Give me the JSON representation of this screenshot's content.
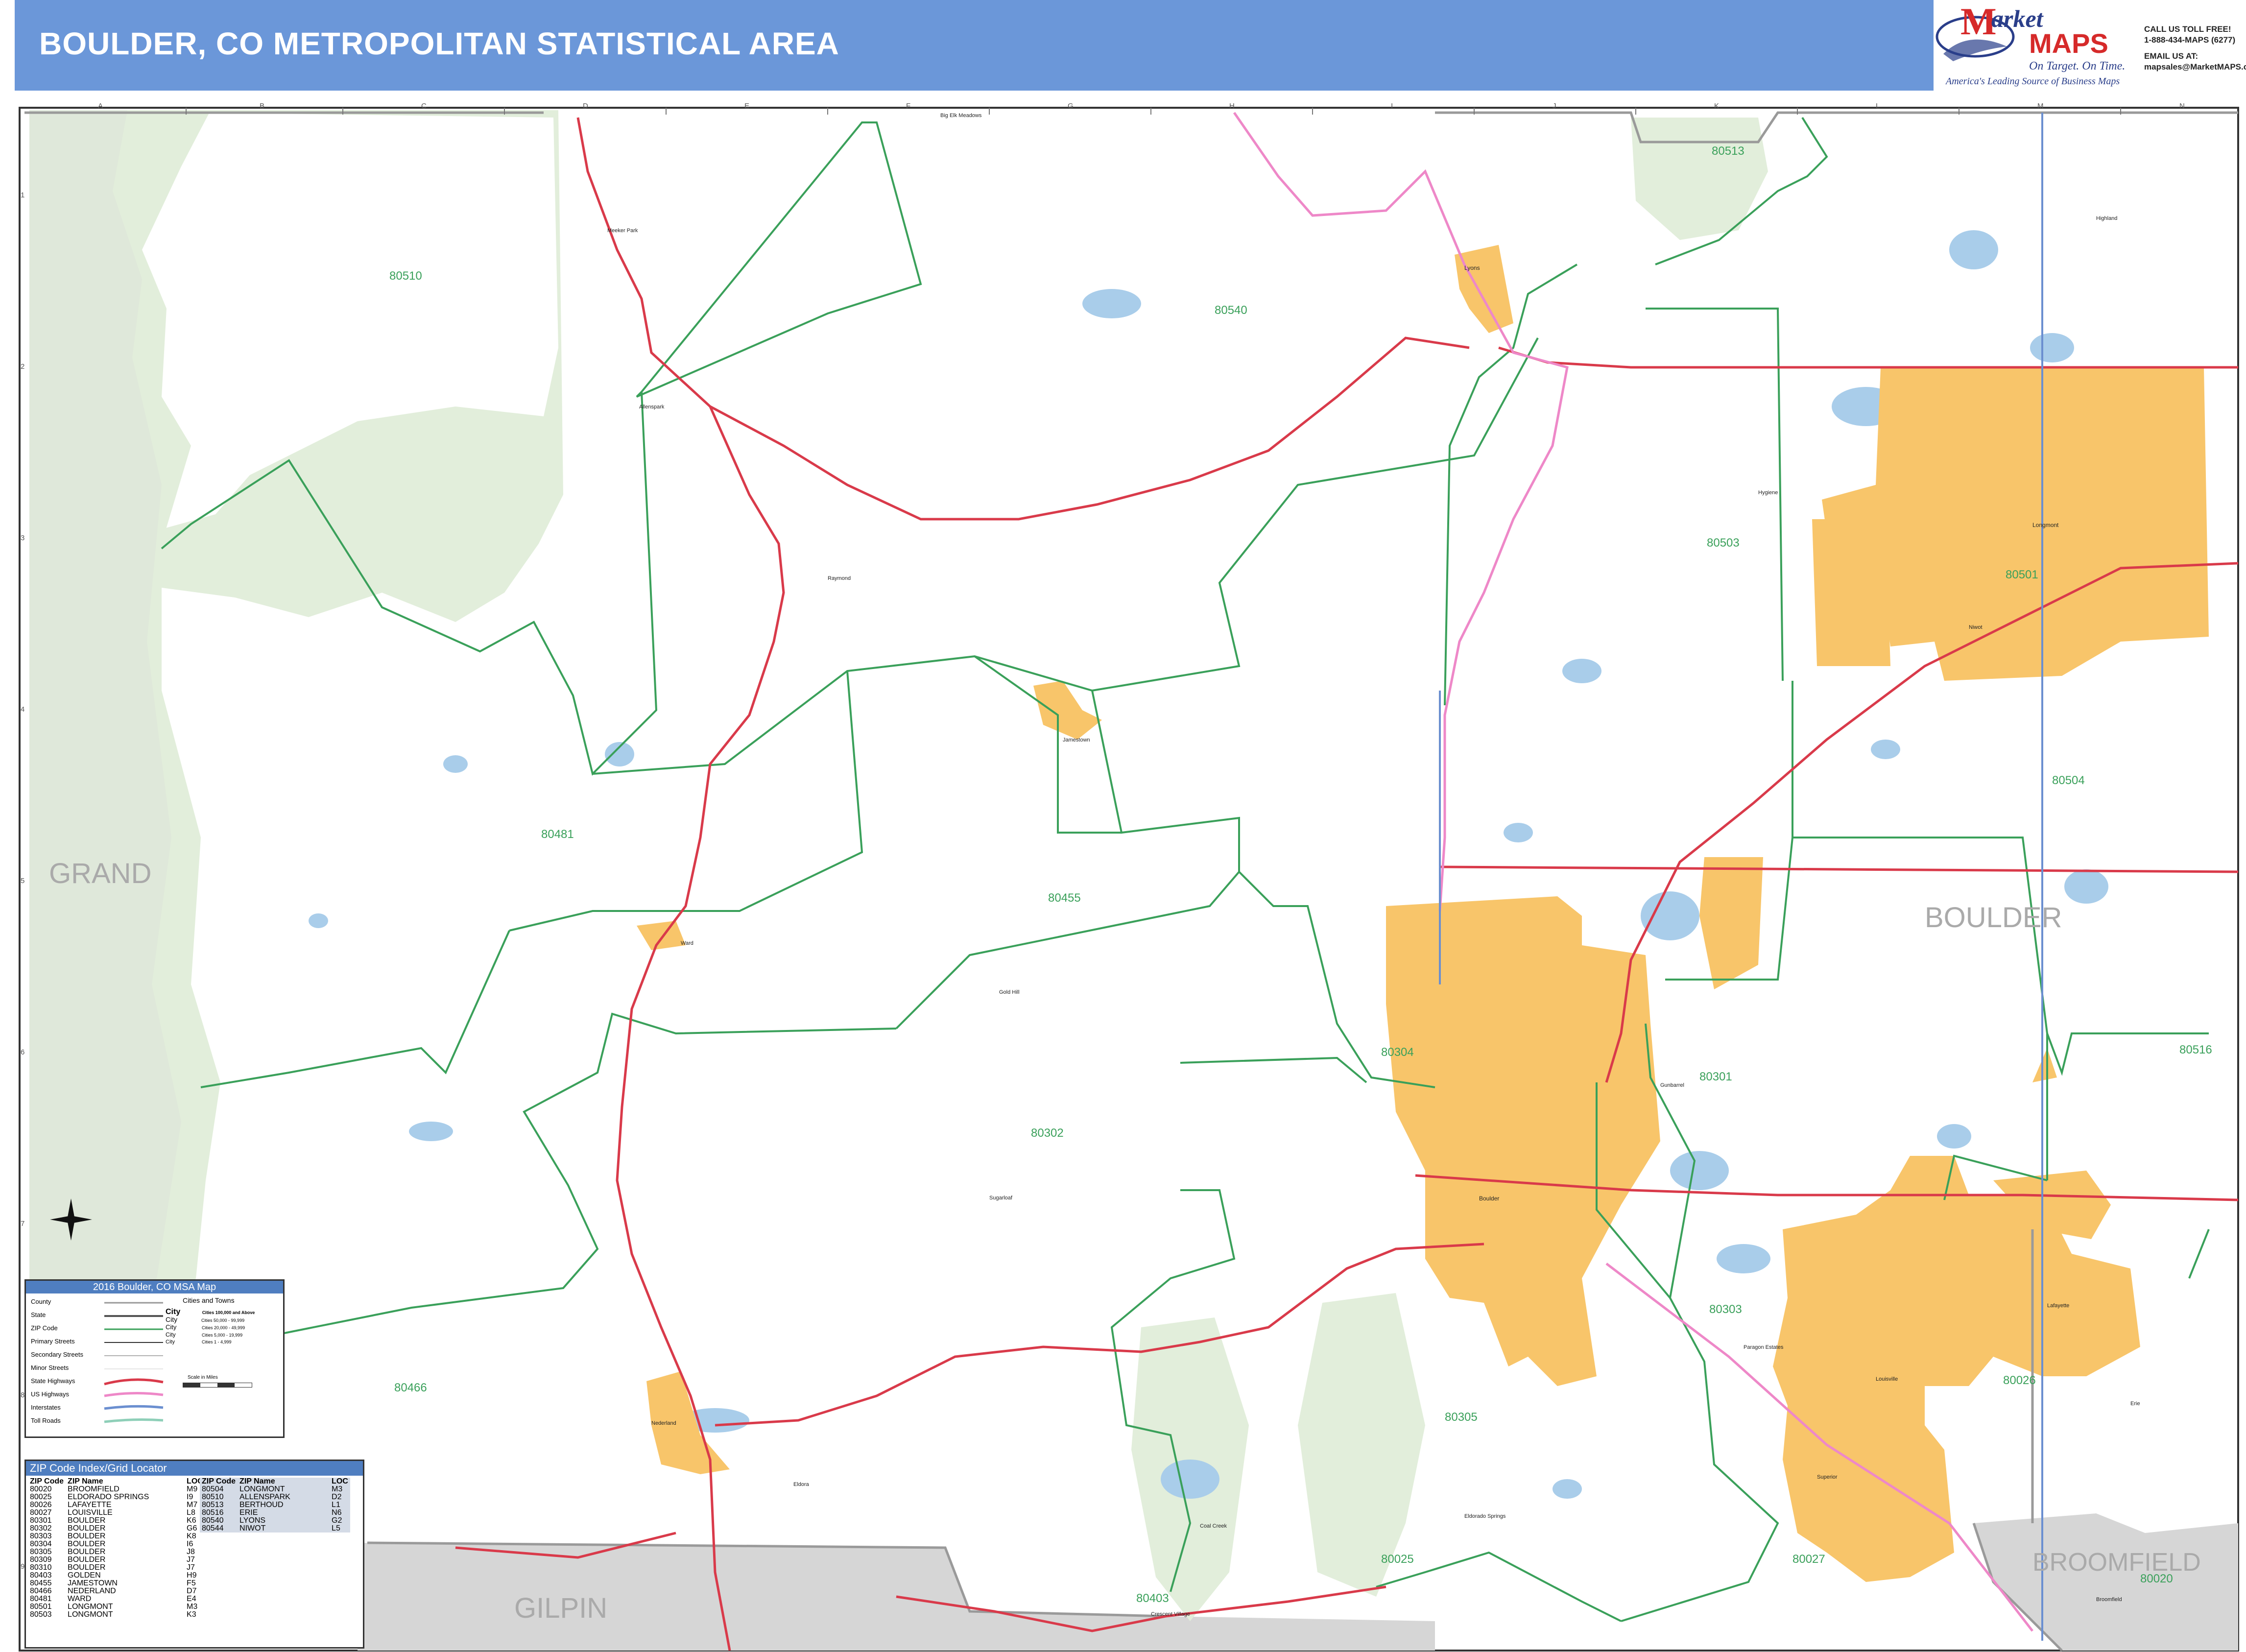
{
  "header": {
    "title": "BOULDER, CO METROPOLITAN STATISTICAL AREA",
    "bg_color": "#6b97d9"
  },
  "brand": {
    "logo_m": "M",
    "logo_rest": "arket",
    "logo_maps": "MAPS",
    "tagline1": "On Target.  On Time.",
    "tagline2": "America's Leading Source of Business Maps",
    "call": "CALL US TOLL FREE!",
    "phone": "1-888-434-MAPS (6277)",
    "email_label": "EMAIL US AT:",
    "email": "mapsales@MarketMAPS.com"
  },
  "grid": {
    "columns": [
      "A",
      "B",
      "C",
      "D",
      "E",
      "F",
      "G",
      "H",
      "I",
      "J",
      "K",
      "L",
      "M",
      "N"
    ],
    "rows": [
      "1",
      "2",
      "3",
      "4",
      "5",
      "6",
      "7",
      "8",
      "9"
    ]
  },
  "counties": {
    "grand": "GRAND",
    "boulder": "BOULDER",
    "gilpin": "GILPIN",
    "broomfield": "BROOMFIELD"
  },
  "zips": {
    "z80510": "80510",
    "z80540": "80540",
    "z80513": "80513",
    "z80503": "80503",
    "z80501": "80501",
    "z80504": "80504",
    "z80481": "80481",
    "z80455": "80455",
    "z80304": "80304",
    "z80301": "80301",
    "z80516": "80516",
    "z80302": "80302",
    "z80303": "80303",
    "z80026": "80026",
    "z80466": "80466",
    "z80305": "80305",
    "z80027": "80027",
    "z80025": "80025",
    "z80403": "80403",
    "z80020": "80020"
  },
  "places": {
    "big_elk": "Big Elk Meadows",
    "meeker": "Meeker Park",
    "lyons": "Lyons",
    "longmont": "Longmont",
    "allenspark": "Allenspark",
    "raymond": "Raymond",
    "jamestown": "Jamestown",
    "ward": "Ward",
    "gold_hill": "Gold Hill",
    "niwot": "Niwot",
    "gunbarrel": "Gunbarrel",
    "boulder": "Boulder",
    "sugarloaf": "Sugarloaf",
    "nederland": "Nederland",
    "eldora": "Eldora",
    "superior": "Superior",
    "louisville": "Louisville",
    "lafayette": "Lafayette",
    "erie": "Erie",
    "broomfield": "Broomfield",
    "eldorado": "Eldorado Springs",
    "coal_creek": "Coal Creek",
    "crescent": "Crescent Village",
    "hygiene": "Hygiene",
    "highland": "Highland",
    "paragon": "Paragon Estates"
  },
  "legend": {
    "title": "2016 Boulder, CO MSA Map",
    "items": [
      "County",
      "State",
      "ZIP Code",
      "Primary Streets",
      "Secondary Streets",
      "Minor Streets",
      "State Highways",
      "US Highways",
      "Interstates",
      "Toll Roads"
    ],
    "cities_title": "Cities and Towns",
    "city_samples": [
      "City",
      "City",
      "City",
      "City",
      "City"
    ],
    "city_sizes": [
      "Cities 100,000 and Above",
      "Cities 50,000 - 99,999",
      "Cities 20,000 - 49,999",
      "Cities 5,000 - 19,999",
      "Cities 1 - 4,999"
    ],
    "scale": "Scale in Miles"
  },
  "zip_index": {
    "title": "ZIP Code Index/Grid Locator",
    "headers": [
      "ZIP Code",
      "ZIP Name",
      "LOC",
      "ZIP Code",
      "ZIP Name",
      "LOC"
    ],
    "left": [
      [
        "80020",
        "BROOMFIELD",
        "M9"
      ],
      [
        "80025",
        "ELDORADO SPRINGS",
        "I9"
      ],
      [
        "80026",
        "LAFAYETTE",
        "M7"
      ],
      [
        "80027",
        "LOUISVILLE",
        "L8"
      ],
      [
        "80301",
        "BOULDER",
        "K6"
      ],
      [
        "80302",
        "BOULDER",
        "G6"
      ],
      [
        "80303",
        "BOULDER",
        "K8"
      ],
      [
        "80304",
        "BOULDER",
        "I6"
      ],
      [
        "80305",
        "BOULDER",
        "J8"
      ],
      [
        "80309",
        "BOULDER",
        "J7"
      ],
      [
        "80310",
        "BOULDER",
        "J7"
      ],
      [
        "80403",
        "GOLDEN",
        "H9"
      ],
      [
        "80455",
        "JAMESTOWN",
        "F5"
      ],
      [
        "80466",
        "NEDERLAND",
        "D7"
      ],
      [
        "80481",
        "WARD",
        "E4"
      ],
      [
        "80501",
        "LONGMONT",
        "M3"
      ],
      [
        "80503",
        "LONGMONT",
        "K3"
      ]
    ],
    "right": [
      [
        "80504",
        "LONGMONT",
        "M3"
      ],
      [
        "80510",
        "ALLENSPARK",
        "D2"
      ],
      [
        "80513",
        "BERTHOUD",
        "L1"
      ],
      [
        "80516",
        "ERIE",
        "N6"
      ],
      [
        "80540",
        "LYONS",
        "G2"
      ],
      [
        "80544",
        "NIWOT",
        "L5"
      ]
    ]
  },
  "colors": {
    "forest": "#e2eedb",
    "city": "#f8c56a",
    "water": "#a9cdea",
    "county_grey": "#d6d6d6",
    "zip_line": "#3aa05a",
    "highway": "#d93a4a",
    "interstate_pink": "#ee88c8"
  }
}
